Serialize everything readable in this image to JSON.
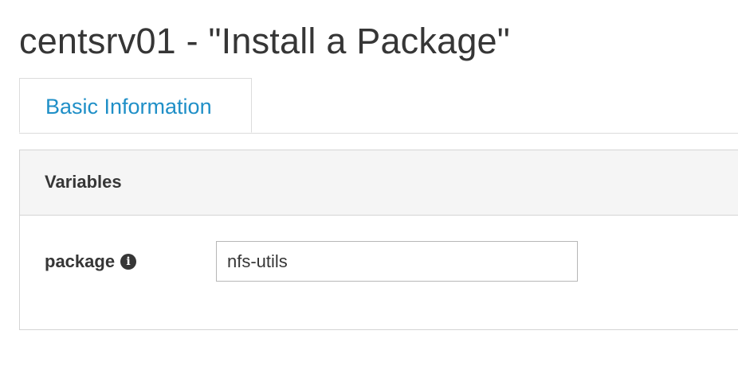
{
  "page": {
    "title": "centsrv01 - \"Install a Package\""
  },
  "tabs": [
    {
      "label": "Basic Information",
      "active": true
    }
  ],
  "variables_panel": {
    "title": "Variables",
    "fields": [
      {
        "label": "package",
        "icon": "info-icon",
        "value": "nfs-utils"
      }
    ]
  },
  "colors": {
    "tab_active_text": "#1f8fc7",
    "header_bg": "#f5f5f5",
    "text": "#363636",
    "border": "#d4d4d4"
  }
}
